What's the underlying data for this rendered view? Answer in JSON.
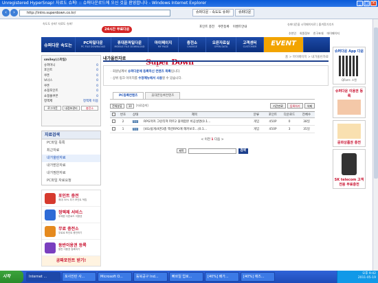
{
  "window": {
    "title": "Unregistered HyperSnap! 자료도 슈퍼! :: 슈퍼다운로드에 오신 것을 환영합니다 - Windows Internet Explorer"
  },
  "browser": {
    "url": "http://intro.superdown.co.kr/",
    "tabs": [
      "슈퍼다운 - 속도도 슈퍼!",
      "슈퍼다운"
    ]
  },
  "site": {
    "logo": "Super Down",
    "logo_sub": "속도도 슈퍼! 자료도 슈퍼!",
    "hot_badge": "24시간 무료다운",
    "top_links": [
      "포인트 충전",
      "쿠폰등록",
      "이벤트안내"
    ],
    "top_links2": [
      "추천인",
      "회원정보",
      "친구초대",
      "마이페이지"
    ],
    "login_note": "슈퍼다운을 시작페이지로 | 즐겨찾기추가",
    "nav": [
      {
        "title": "슈퍼다운 속도는",
        "sub": ""
      },
      {
        "title": "PC파일다운",
        "sub": "PC FILE DOWNLOAD"
      },
      {
        "title": "휴대폰파일다운",
        "sub": "MOBILE FILE DOWNLOAD"
      },
      {
        "title": "마이페이지",
        "sub": "MY PAGE"
      },
      {
        "title": "충전소",
        "sub": "CHARGE"
      },
      {
        "title": "오픈자료실",
        "sub": "OPEN DATA"
      },
      {
        "title": "고객센터",
        "sub": "CUSTOMER"
      }
    ],
    "event_label": "EVENT"
  },
  "user": {
    "name": "smiley(스마일)",
    "rows": [
      {
        "k": "슈퍼머니",
        "v": "0"
      },
      {
        "k": "포인트",
        "v": "0"
      },
      {
        "k": "쿠폰",
        "v": "0"
      },
      {
        "k": "보너스",
        "v": "0"
      },
      {
        "k": "쿠폰",
        "v": "0"
      },
      {
        "k": "쇼핑포인트",
        "v": "0"
      },
      {
        "k": "쇼핑몰쿠폰",
        "v": "0"
      },
      {
        "k": "정액제",
        "v": "정액제 이용"
      }
    ],
    "buttons": [
      "로그아웃",
      "내정보관리",
      "충전소"
    ]
  },
  "category": {
    "heading": "자료검색",
    "items": [
      "PC파일 목록",
      "최근자료",
      "내가올린자료",
      "내가받은자료",
      "내가찜한자료",
      "PC파일 자료요청"
    ],
    "active_index": 2
  },
  "ads": [
    {
      "title": "포인트 충전",
      "desc": "최대 30% 추가 포인트 적립"
    },
    {
      "title": "정액제 서비스",
      "desc": "무제한 다운로드 이용권"
    },
    {
      "title": "무료 충전소",
      "desc": "무료로 포인트 충전하기"
    },
    {
      "title": "동반이용권 등록",
      "desc": "동반 이용권 등록하기"
    }
  ],
  "ad_footer": "공짜포인트 받기!",
  "main": {
    "page_title": "내가올린자료",
    "breadcrumb": "홈 > 마이페이지 > 내가올린자료",
    "info1_pre": "회원님께서 ",
    "info1_bold": "슈퍼다운에 등록하신 컨텐츠 목록",
    "info1_post": "입니다.",
    "info2_pre": "상위 링크 이미지를 ",
    "info2_bold": "수정메뉴에서 사용",
    "info2_post": "할 수 있습니다.",
    "tabs": [
      "PC등록컨텐츠",
      "휴대폰등록컨텐츠"
    ],
    "filter_sel1": "전체분류",
    "filter_sel2": "10",
    "filter_text": "[자료검색]",
    "filter_buttons": [
      "기간만료",
      "등록하기",
      "삭제"
    ],
    "columns": [
      "",
      "번호",
      "상태",
      "제목",
      "분류",
      "포인트",
      "다운로드",
      "전체수"
    ],
    "rows": [
      {
        "num": "2",
        "status": "정상",
        "title": "RPG마커 그린티져 파트2 블랙합본 비공설명(0.1...",
        "cat": "게임",
        "point": "450P",
        "down": "0",
        "total": "38일"
      },
      {
        "num": "1",
        "status": "정상",
        "title": "[4G/쉽게/4면3총 액션RPG에 해커보호...(0.1...",
        "cat": "게임",
        "point": "450P",
        "down": "3",
        "total": "35일"
      }
    ],
    "pager": {
      "prev": "< 이전",
      "current": "1",
      "next": "다음 >"
    },
    "search_select": "제목",
    "search_button": "검색"
  },
  "right": [
    {
      "h": "슈퍼다운 App 다운",
      "s": "QR코드 스캔",
      "red": false
    },
    {
      "h": "슈퍼다운 이용권 등록",
      "s": "",
      "red": true
    },
    {
      "h": "문화상품권 충전",
      "s": "",
      "red": true
    },
    {
      "h": "SK telecom 고객전용 무료충전",
      "s": "",
      "red": true
    }
  ],
  "taskbar": {
    "start": "시작",
    "tasks": [
      "Internet ...",
      "포사진란 사...",
      "Microsoft O...",
      "동북공구 Ind...",
      "빠르일 업로...",
      "[40%] 배가...",
      "[40%] 애즈..."
    ],
    "active_index": 0,
    "time": "오후 9:42",
    "date": "2011-05-19"
  }
}
